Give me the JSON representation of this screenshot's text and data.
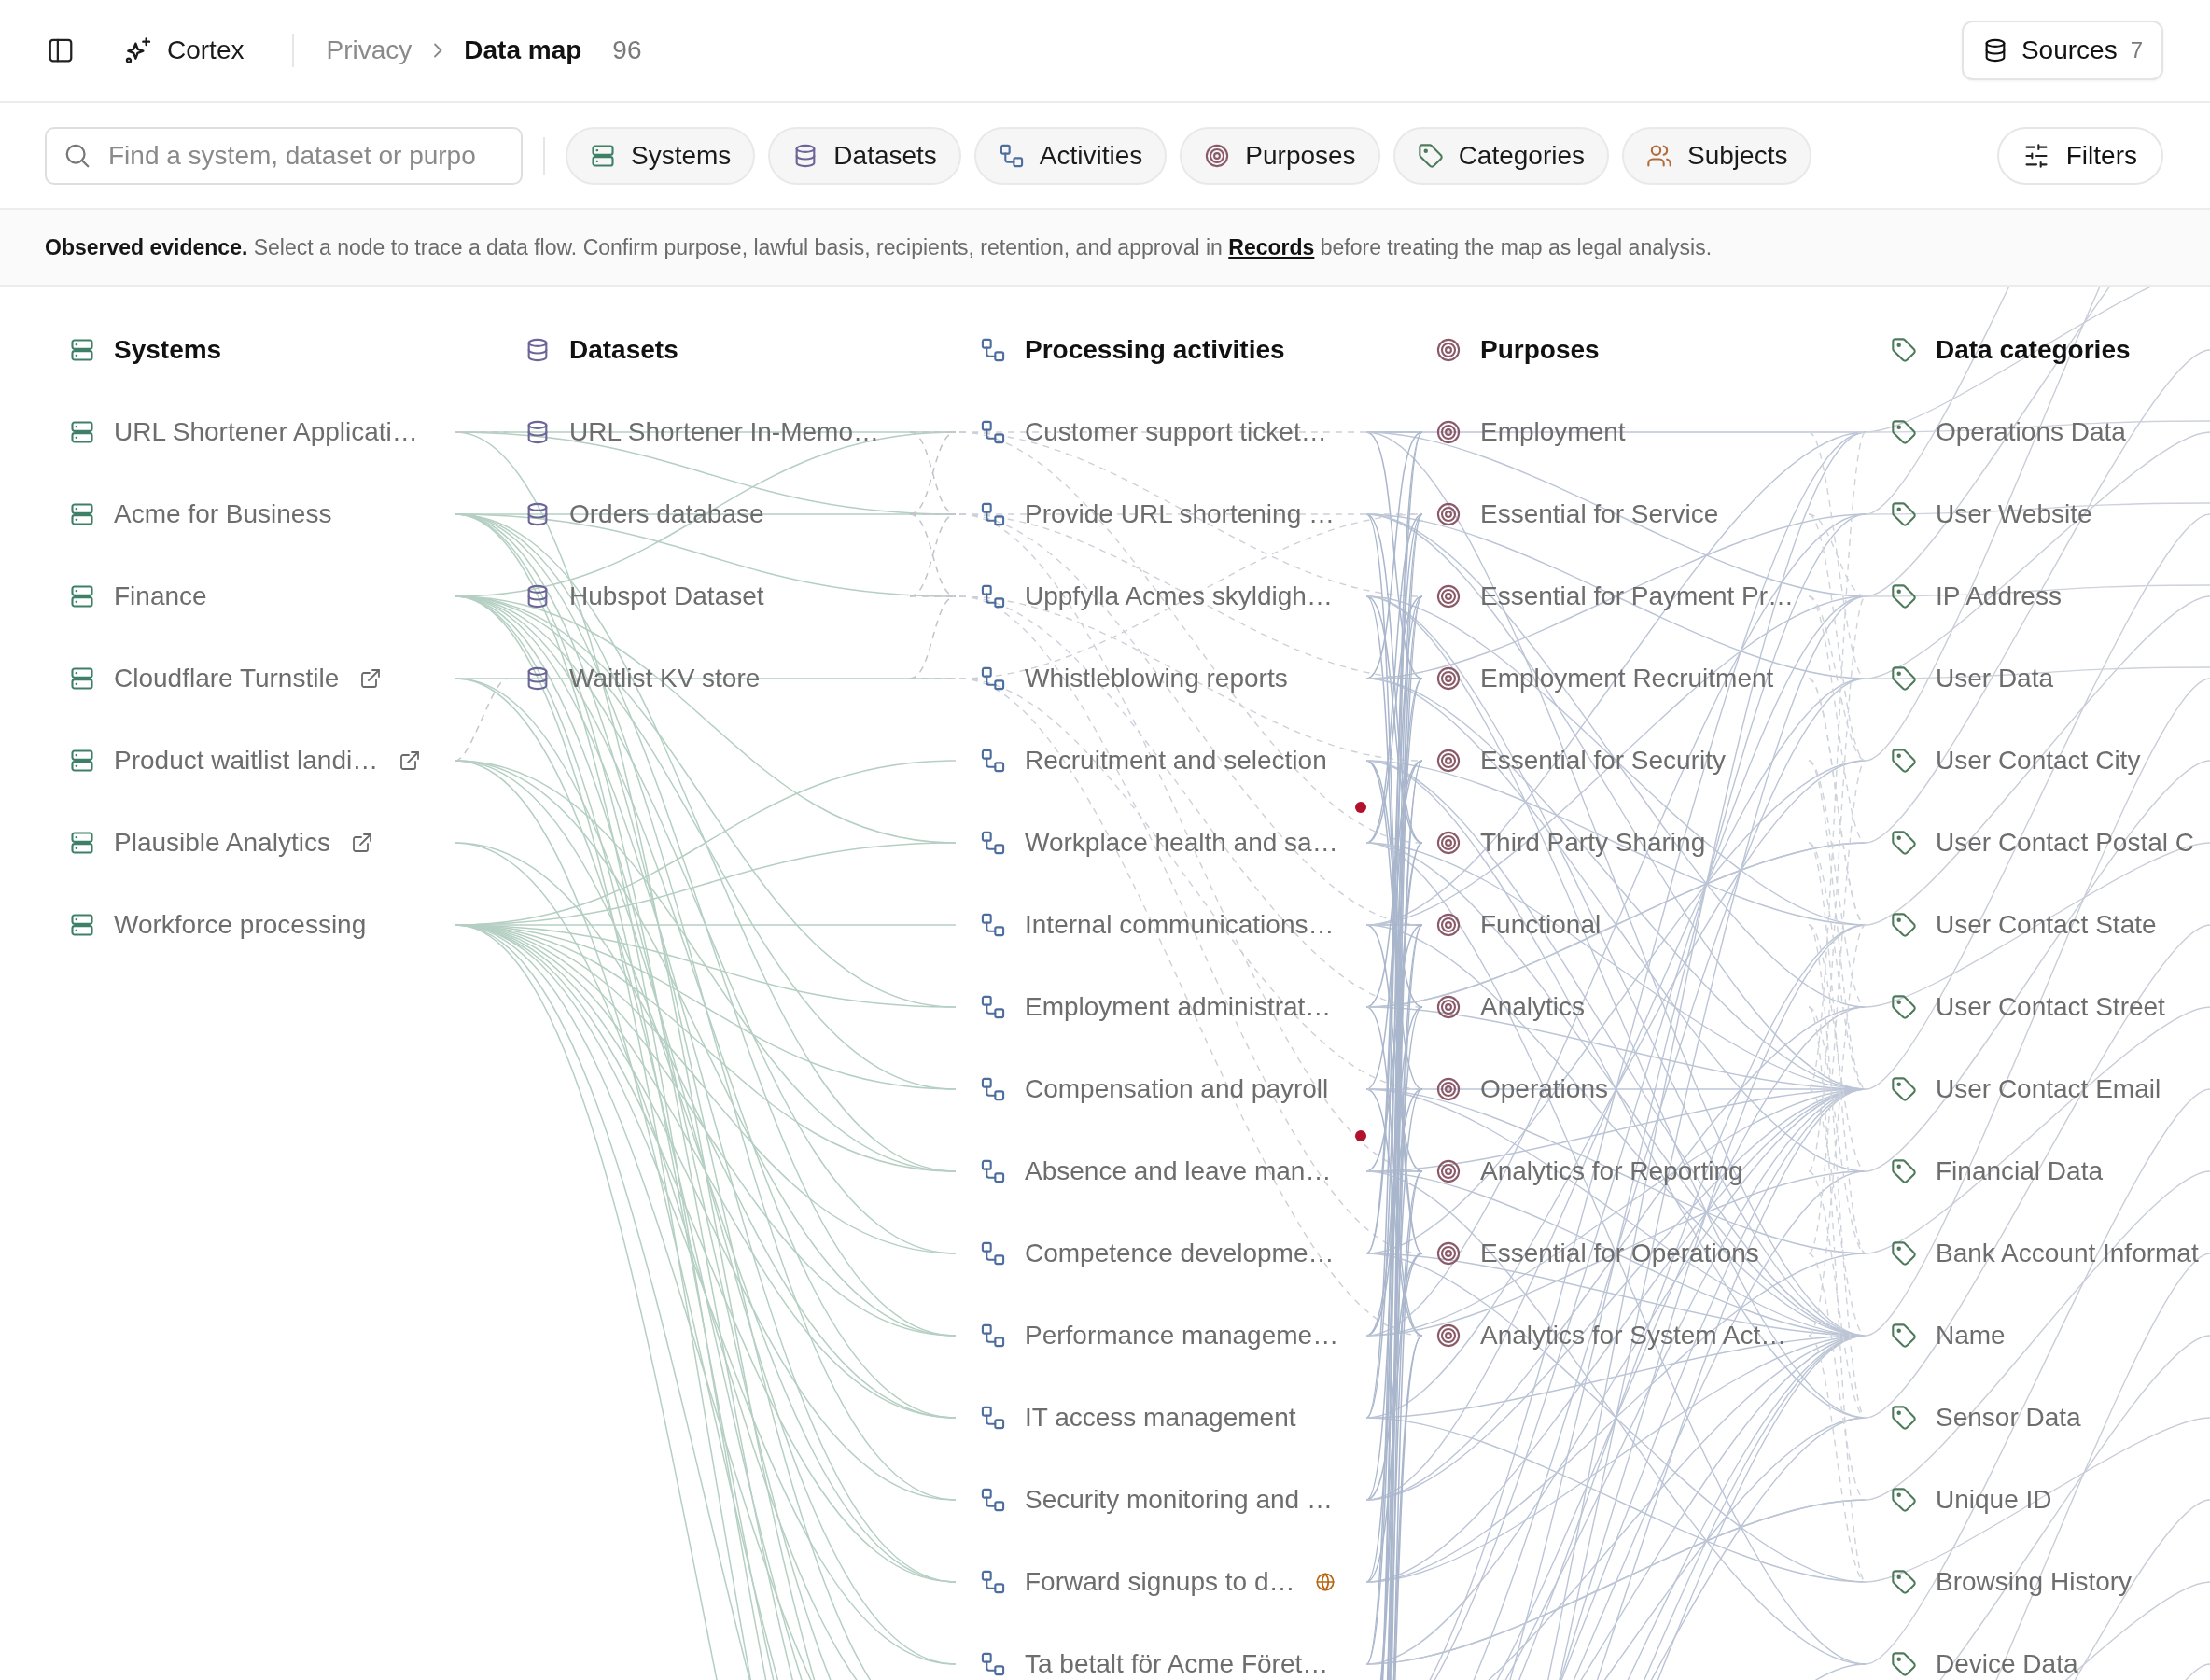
{
  "header": {
    "app_name": "Cortex",
    "breadcrumb": [
      {
        "label": "Privacy",
        "current": false
      },
      {
        "label": "Data map",
        "current": true
      }
    ],
    "count": "96",
    "sources_button": {
      "label": "Sources",
      "count": "7"
    }
  },
  "toolbar": {
    "search": {
      "placeholder": "Find a system, dataset or purpo"
    },
    "chips": [
      {
        "kind": "systems",
        "label": "Systems"
      },
      {
        "kind": "datasets",
        "label": "Datasets"
      },
      {
        "kind": "activities",
        "label": "Activities"
      },
      {
        "kind": "purposes",
        "label": "Purposes"
      },
      {
        "kind": "categories",
        "label": "Categories"
      },
      {
        "kind": "subjects",
        "label": "Subjects"
      }
    ],
    "filters_button": {
      "label": "Filters"
    }
  },
  "notice": {
    "text": "**Observed evidence.** Select a node to trace a data flow. Confirm purpose, lawful basis, recipients, retention, and approval in",
    "link": "Records",
    "text_after": "before treating the map as legal analysis."
  },
  "columns": [
    {
      "kind": "systems",
      "title": "Systems",
      "nodes": [
        {
          "label": "URL Shortener Applicati…",
          "kind": "plain"
        },
        {
          "label": "Acme for Business",
          "kind": "plain"
        },
        {
          "label": "Finance",
          "kind": "plain"
        },
        {
          "label": "Cloudflare Turnstile",
          "kind": "external"
        },
        {
          "label": "Product waitlist landi…",
          "kind": "external"
        },
        {
          "label": "Plausible Analytics",
          "kind": "external"
        },
        {
          "label": "Workforce processing",
          "kind": "plain"
        }
      ]
    },
    {
      "kind": "datasets",
      "title": "Datasets",
      "nodes": [
        {
          "label": "URL Shortener In-Memo…"
        },
        {
          "label": "Orders database"
        },
        {
          "label": "Hubspot Dataset"
        },
        {
          "label": "Waitlist KV store"
        }
      ]
    },
    {
      "kind": "activities",
      "title": "Processing activities",
      "nodes": [
        {
          "label": "Customer support ticket…",
          "kind": "plain",
          "flagged": false
        },
        {
          "label": "Provide URL shortening …",
          "kind": "plain",
          "flagged": false
        },
        {
          "label": "Uppfylla Acmes skyldigh…",
          "kind": "plain",
          "flagged": false
        },
        {
          "label": "Whistleblowing reports",
          "kind": "plain",
          "flagged": false
        },
        {
          "label": "Recruitment and selection",
          "kind": "plain",
          "flagged": true
        },
        {
          "label": "Workplace health and sa…",
          "kind": "plain",
          "flagged": false
        },
        {
          "label": "Internal communications…",
          "kind": "plain",
          "flagged": false
        },
        {
          "label": "Employment administrat…",
          "kind": "plain",
          "flagged": false
        },
        {
          "label": "Compensation and payroll",
          "kind": "plain",
          "flagged": true
        },
        {
          "label": "Absence and leave man…",
          "kind": "plain",
          "flagged": false
        },
        {
          "label": "Competence developme…",
          "kind": "plain",
          "flagged": false
        },
        {
          "label": "Performance manageme…",
          "kind": "plain",
          "flagged": false
        },
        {
          "label": "IT access management",
          "kind": "plain",
          "flagged": false
        },
        {
          "label": "Security monitoring and …",
          "kind": "plain",
          "flagged": false
        },
        {
          "label": "Forward signups to d…",
          "kind": "web",
          "flagged": false
        },
        {
          "label": "Ta betalt för Acme Föret…",
          "kind": "plain",
          "flagged": false
        }
      ]
    },
    {
      "kind": "purposes",
      "title": "Purposes",
      "nodes": [
        {
          "label": "Employment"
        },
        {
          "label": "Essential for Service"
        },
        {
          "label": "Essential for Payment Pr…"
        },
        {
          "label": "Employment Recruitment"
        },
        {
          "label": "Essential for Security"
        },
        {
          "label": "Third Party Sharing"
        },
        {
          "label": "Functional"
        },
        {
          "label": "Analytics"
        },
        {
          "label": "Operations"
        },
        {
          "label": "Analytics for Reporting"
        },
        {
          "label": "Essential for Operations"
        },
        {
          "label": "Analytics for System Act…"
        }
      ]
    },
    {
      "kind": "categories",
      "title": "Data categories",
      "nodes": [
        {
          "label": "Operations Data"
        },
        {
          "label": "User Website"
        },
        {
          "label": "IP Address"
        },
        {
          "label": "User Data"
        },
        {
          "label": "User Contact City"
        },
        {
          "label": "User Contact Postal C"
        },
        {
          "label": "User Contact State"
        },
        {
          "label": "User Contact Street"
        },
        {
          "label": "User Contact Email"
        },
        {
          "label": "Financial Data"
        },
        {
          "label": "Bank Account Informat"
        },
        {
          "label": "Name"
        },
        {
          "label": "Sensor Data"
        },
        {
          "label": "Unique ID"
        },
        {
          "label": "Browsing History"
        },
        {
          "label": "Device Data"
        }
      ]
    }
  ]
}
